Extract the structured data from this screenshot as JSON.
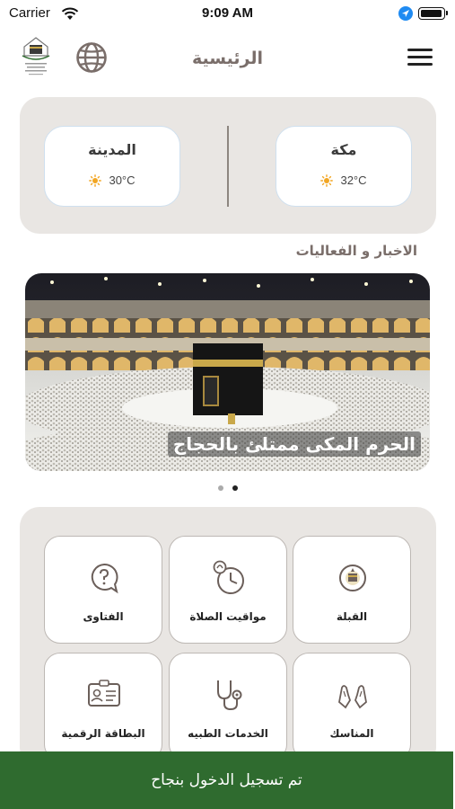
{
  "status_bar": {
    "carrier": "Carrier",
    "time": "9:09 AM"
  },
  "header": {
    "title": "الرئيسية",
    "logo_icon": "ministry-logo",
    "language_icon": "globe-icon",
    "menu_icon": "hamburger-icon"
  },
  "weather": {
    "cities": [
      {
        "name": "مكة",
        "temp": "32°C",
        "icon": "sun-icon"
      },
      {
        "name": "المدينة",
        "temp": "30°C",
        "icon": "sun-icon"
      }
    ]
  },
  "news": {
    "section_title": "الاخبار و الفعاليات",
    "caption": "الحرم المكى ممتلئ بالحجاج",
    "pages": 2,
    "active_page": 2
  },
  "services": [
    {
      "label": "القبلة",
      "icon": "qibla-icon"
    },
    {
      "label": "مواقيت الصلاة",
      "icon": "prayer-clock-icon"
    },
    {
      "label": "الفتاوى",
      "icon": "fatwa-question-icon"
    },
    {
      "label": "المناسك",
      "icon": "praying-hands-icon"
    },
    {
      "label": "الخدمات الطبيه",
      "icon": "stethoscope-icon"
    },
    {
      "label": "البطاقة الرقمية",
      "icon": "id-card-icon"
    }
  ],
  "toast": {
    "message": "تم تسجيل الدخول بنجاح"
  },
  "colors": {
    "toast_bg": "#2f6b2f",
    "panel_bg": "#e9e6e3",
    "title_color": "#7a6e6a",
    "sun": "#f2a623"
  }
}
